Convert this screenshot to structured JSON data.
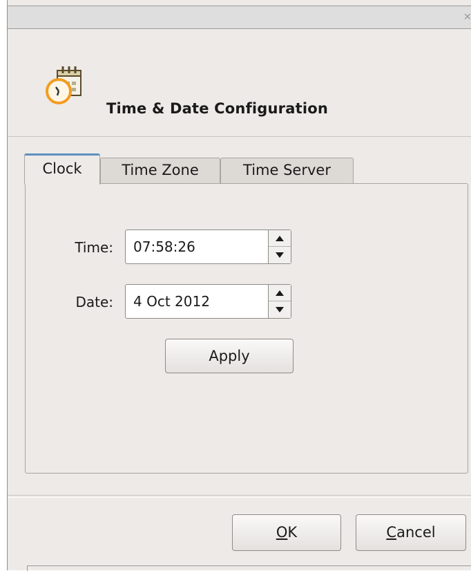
{
  "dialog": {
    "title": "Time & Date Configuration"
  },
  "tabs": [
    {
      "label": "Clock",
      "active": true
    },
    {
      "label": "Time Zone",
      "active": false
    },
    {
      "label": "Time Server",
      "active": false
    }
  ],
  "clock": {
    "time_label": "Time:",
    "time_value": "07:58:26",
    "date_label": "Date:",
    "date_value": "4 Oct 2012",
    "apply_label": "Apply"
  },
  "footer": {
    "ok_mnemonic": "O",
    "ok_rest": "K",
    "cancel_mnemonic": "C",
    "cancel_rest": "ancel"
  },
  "icons": {
    "titlebar_close": "close-icon",
    "app": "calendar-clock-icon"
  },
  "colors": {
    "window_bg": "#edeae7",
    "accent_tab": "#5f8fc0",
    "icon_orange": "#f39c1f"
  }
}
